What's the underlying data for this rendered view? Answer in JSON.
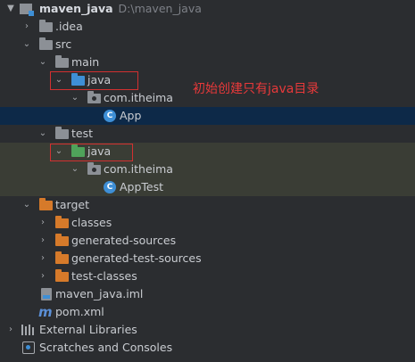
{
  "project": {
    "name": "maven_java",
    "path": "D:\\maven_java"
  },
  "tree": {
    "idea": ".idea",
    "src": "src",
    "main": "main",
    "main_java": "java",
    "main_pkg": "com.itheima",
    "app": "App",
    "test": "test",
    "test_java": "java",
    "test_pkg": "com.itheima",
    "apptest": "AppTest",
    "target": "target",
    "classes": "classes",
    "generated_sources": "generated-sources",
    "generated_test_sources": "generated-test-sources",
    "test_classes": "test-classes",
    "iml": "maven_java.iml",
    "pom": "pom.xml",
    "external_libraries": "External Libraries",
    "scratches": "Scratches and Consoles"
  },
  "annotation": "初始创建只有java目录",
  "colors": {
    "background": "#2b2d30",
    "selection": "#0d2948",
    "test_band": "#3a3d35",
    "highlight_box": "#d23030",
    "annotation_text": "#e8393a"
  }
}
